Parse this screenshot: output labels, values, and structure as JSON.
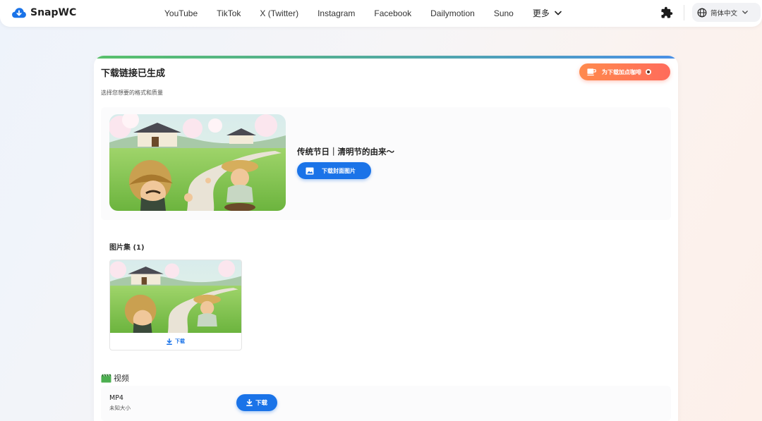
{
  "brand": {
    "name": "SnapWC"
  },
  "nav": {
    "items": [
      "YouTube",
      "TikTok",
      "X (Twitter)",
      "Instagram",
      "Facebook",
      "Dailymotion",
      "Suno"
    ],
    "more_label": "更多",
    "language": "简体中文"
  },
  "card": {
    "title": "下载链接已生成",
    "subtitle": "选择您想要的格式和质量",
    "coffee_button": "为下载加点咖啡"
  },
  "media": {
    "title": "传统节日｜清明节的由来～",
    "cover_button": "下载封面图片"
  },
  "gallery": {
    "title": "图片集 (1)",
    "items": [
      {
        "download_label": "下载"
      }
    ]
  },
  "video": {
    "section_title": "视频",
    "formats": [
      {
        "name": "MP4",
        "size": "未知大小",
        "download_label": "下载"
      }
    ]
  },
  "colors": {
    "primary": "#1a73e8",
    "coffee_start": "#ff8a4c",
    "coffee_end": "#ff6b5b",
    "accent_green": "#58c06a",
    "video_icon": "#4caf50"
  },
  "icons": {
    "logo": "cloud-download-icon",
    "more": "chevron-down-icon",
    "extensions": "puzzle-icon",
    "language": "globe-icon",
    "coffee": "coffee-cup-icon",
    "cover": "image-icon",
    "download": "download-arrow-icon",
    "video": "clapperboard-icon"
  }
}
